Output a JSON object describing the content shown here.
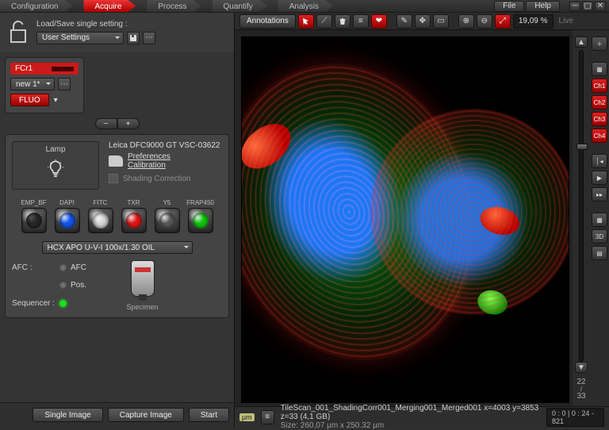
{
  "tabs": {
    "items": [
      "Configuration",
      "Acquire",
      "Process",
      "Quantify",
      "Analysis"
    ],
    "active_index": 1
  },
  "menu": {
    "file": "File",
    "help": "Help"
  },
  "loadsave": {
    "title": "Load/Save single setting :",
    "dropdown": "User Settings"
  },
  "fcr": {
    "name": "FCr1",
    "preset": "new 1*",
    "mode": "FLUO"
  },
  "instrument": {
    "lamp_label": "Lamp",
    "camera_name": "Leica DFC9000 GT VSC-03622",
    "pref_link": "Preferences",
    "cal_link": "Calibration",
    "shading_label": "Shading Correction",
    "cubes": [
      {
        "label": "EMP_BF",
        "color": "#6b6b6b",
        "dim": true
      },
      {
        "label": "DAPI",
        "color": "#1155ee",
        "dim": false
      },
      {
        "label": "FITC",
        "color": "#d8d8d8",
        "dim": false
      },
      {
        "label": "TXR",
        "color": "#e01515",
        "dim": false
      },
      {
        "label": "Y5",
        "color": "#5a5a5a",
        "dim": false
      },
      {
        "label": "FRAP450",
        "color": "#10c810",
        "dim": false
      }
    ],
    "objective": "HCX APO U-V-I   100x/1.30 OIL",
    "specimen_label": "Specimen",
    "status": {
      "afc_hdr": "AFC :",
      "afc_label": "AFC",
      "pos_label": "Pos.",
      "seq_hdr": "Sequencer :",
      "afc_on": false,
      "pos_on": false,
      "seq_on": true
    }
  },
  "actions": {
    "single": "Single Image",
    "capture": "Capture Image",
    "start": "Start"
  },
  "viewer": {
    "annotations_label": "Annotations",
    "zoom": "19,09 %",
    "live": "Live",
    "z_index": "22",
    "z_total": "33",
    "channels": [
      "Ch1",
      "Ch2",
      "Ch3",
      "Ch4"
    ],
    "btn_3d": "3D"
  },
  "status": {
    "um": "µm",
    "line1": "TileScan_001_ShadingCorr001_Merging001_Merged001 x=4003 y=3853 z=33  (4,1 GB)",
    "line2": "Size: 260,07 µm x 250.32 µm",
    "coords": "0 : 0 | 0 : 24 - 821"
  }
}
